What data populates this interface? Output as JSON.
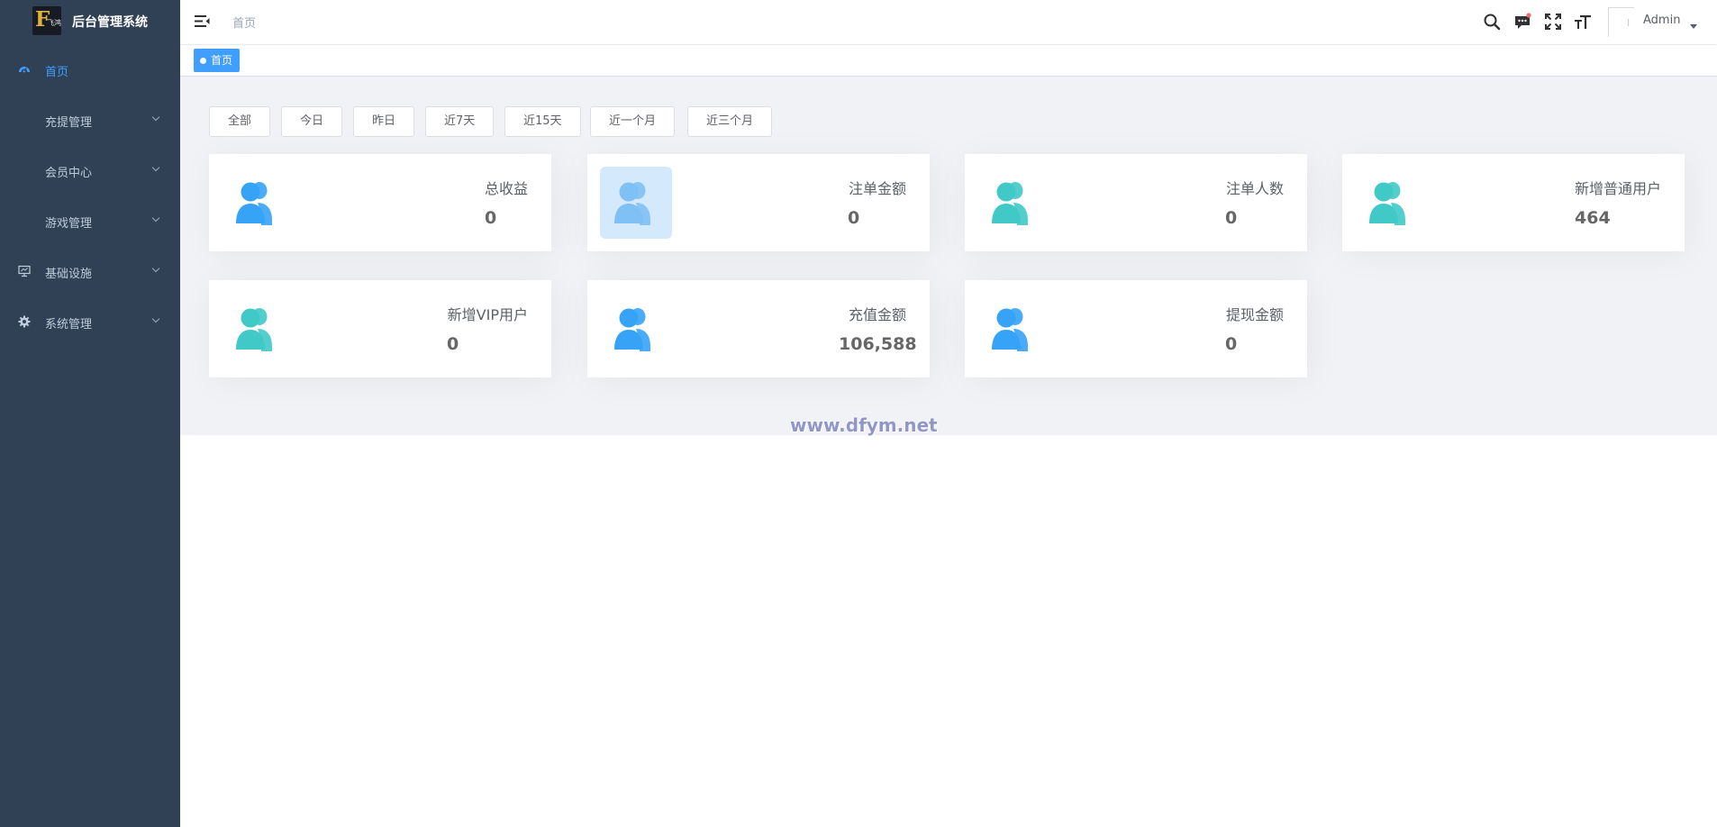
{
  "app": {
    "logo_letter": "F",
    "logo_small_text": "飞鸿",
    "title": "后台管理系统"
  },
  "sidebar": {
    "items": [
      {
        "label": "首页",
        "icon": "dashboard-icon",
        "active": true
      },
      {
        "label": "充提管理",
        "icon": "",
        "active": false
      },
      {
        "label": "会员中心",
        "icon": "",
        "active": false
      },
      {
        "label": "游戏管理",
        "icon": "",
        "active": false
      },
      {
        "label": "基础设施",
        "icon": "monitor-icon",
        "active": false
      },
      {
        "label": "系统管理",
        "icon": "gear-icon",
        "active": false
      }
    ]
  },
  "header": {
    "breadcrumb": "首页",
    "user_name": "Admin",
    "icons": [
      "search-icon",
      "message-icon",
      "fullscreen-icon",
      "font-size-icon"
    ],
    "notification_dot_color": "#f56c6c"
  },
  "tags": {
    "active_tag": "首页"
  },
  "filters": {
    "buttons": [
      "全部",
      "今日",
      "昨日",
      "近7天",
      "近15天",
      "近一个月",
      "近三个月"
    ]
  },
  "stats": {
    "cards": [
      {
        "label": "总收益",
        "value": "0",
        "icon_color": "#36a3f7"
      },
      {
        "label": "注单金额",
        "value": "0",
        "icon_color": "#36a3f7",
        "highlighted": true
      },
      {
        "label": "注单人数",
        "value": "0",
        "icon_color": "#40c9c6"
      },
      {
        "label": "新增普通用户",
        "value": "464",
        "icon_color": "#40c9c6"
      },
      {
        "label": "新增VIP用户",
        "value": "0",
        "icon_color": "#40c9c6"
      },
      {
        "label": "充值金额",
        "value": "106,588",
        "icon_color": "#36a3f7"
      },
      {
        "label": "提现金额",
        "value": "0",
        "icon_color": "#36a3f7"
      }
    ]
  },
  "watermark": "www.dfym.net",
  "colors": {
    "sidebar_bg": "#304156",
    "accent": "#409eff",
    "blue_icon": "#36a3f7",
    "teal_icon": "#40c9c6"
  }
}
